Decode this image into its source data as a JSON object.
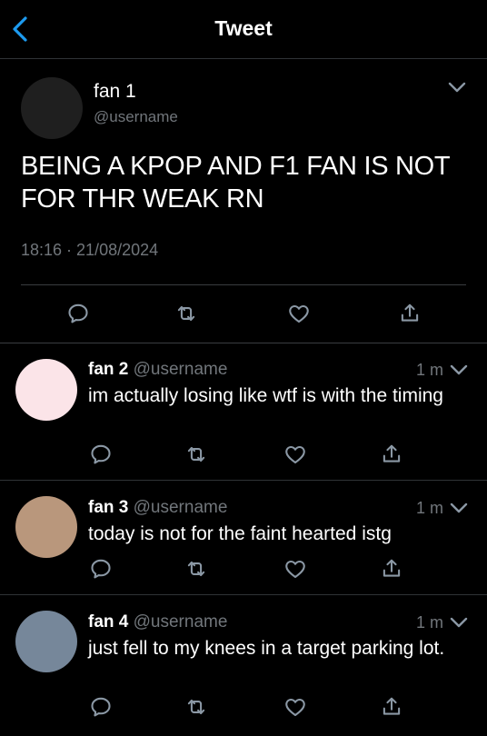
{
  "header": {
    "title": "Tweet"
  },
  "main_tweet": {
    "author_name": "fan 1",
    "author_handle": "@username",
    "text": "BEING A KPOP AND F1 FAN IS NOT FOR THR WEAK RN",
    "timestamp": "18:16 · 21/08/2024"
  },
  "replies": [
    {
      "name": "fan 2",
      "handle": "@username",
      "time": "1 m",
      "text": "im actually losing like wtf is with the timing",
      "avatar_color": "#fbe4e8"
    },
    {
      "name": "fan 3",
      "handle": "@username",
      "time": "1 m",
      "text": "today is not for the faint hearted istg",
      "avatar_color": "#b9977c"
    },
    {
      "name": "fan 4",
      "handle": "@username",
      "time": "1 m",
      "text": "just fell to my knees in a target parking lot.",
      "avatar_color": "#76879a"
    }
  ],
  "colors": {
    "accent": "#1d9bf0",
    "muted": "#71767b",
    "background": "#000000",
    "divider": "#2f3336"
  },
  "icons": [
    "back-chevron-icon",
    "chevron-down-icon",
    "reply-icon",
    "retweet-icon",
    "like-icon",
    "share-icon"
  ]
}
